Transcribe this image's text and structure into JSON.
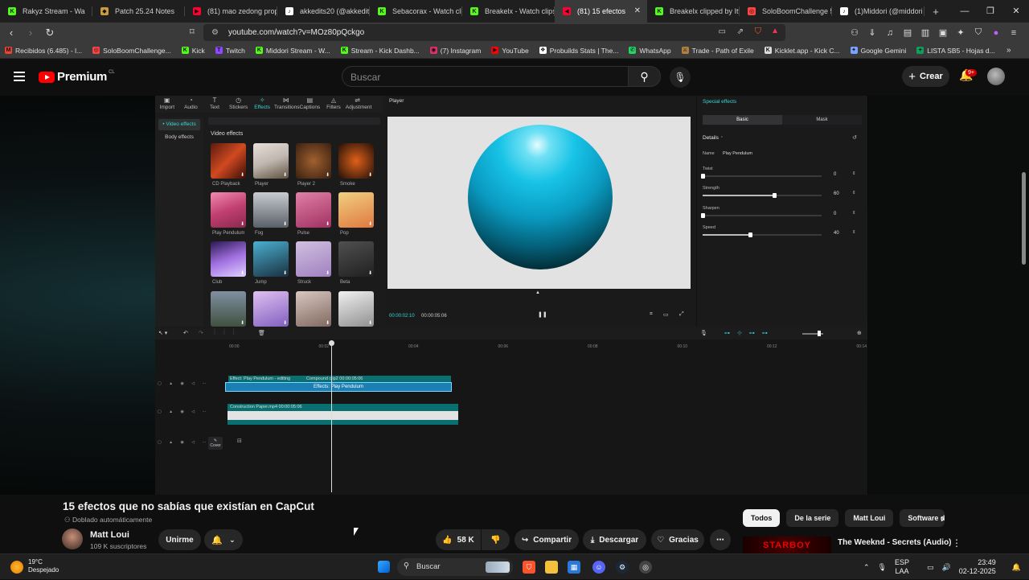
{
  "browser": {
    "tabs": [
      {
        "label": "Rakyz Stream - Wa",
        "fav_color": "#53fc18",
        "fav_glyph": "K"
      },
      {
        "label": "Patch 25.24 Notes",
        "fav_color": "#c89b3c",
        "fav_glyph": "◆"
      },
      {
        "label": "(81) mao zedong prop",
        "fav_color": "#ff0033",
        "fav_glyph": "▶"
      },
      {
        "label": "akkedits20 (@akkedits",
        "fav_color": "#ffffff",
        "fav_glyph": "♪"
      },
      {
        "label": "Sebacorax - Watch clip",
        "fav_color": "#53fc18",
        "fav_glyph": "K"
      },
      {
        "label": "Breakelx - Watch clips",
        "fav_color": "#53fc18",
        "fav_glyph": "K"
      },
      {
        "label": "(81) 15 efectos",
        "fav_color": "#ff0033",
        "fav_glyph": "◀",
        "active": true
      },
      {
        "label": "Breakelx clipped by Itt",
        "fav_color": "#53fc18",
        "fav_glyph": "K"
      },
      {
        "label": "SoloBoomChallenge 5",
        "fav_color": "#ff4444",
        "fav_glyph": "◎"
      },
      {
        "label": "(1)Middori (@middori",
        "fav_color": "#ffffff",
        "fav_glyph": "♪"
      }
    ],
    "url": "youtube.com/watch?v=MOz80pQckgo",
    "bookmarks": [
      {
        "label": "Recibidos (6.485) - l...",
        "color": "#ea4335",
        "glyph": "M"
      },
      {
        "label": "SoloBoomChallenge...",
        "color": "#ff4444",
        "glyph": "◎"
      },
      {
        "label": "Kick",
        "color": "#53fc18",
        "glyph": "K"
      },
      {
        "label": "Twitch",
        "color": "#9146ff",
        "glyph": "T"
      },
      {
        "label": "Middori Stream - W...",
        "color": "#53fc18",
        "glyph": "K"
      },
      {
        "label": "Stream - Kick Dashb...",
        "color": "#53fc18",
        "glyph": "K"
      },
      {
        "label": "(7) Instagram",
        "color": "#e1306c",
        "glyph": "◉"
      },
      {
        "label": "YouTube",
        "color": "#ff0000",
        "glyph": "▶"
      },
      {
        "label": "Probuilds Stats | The...",
        "color": "#ffffff",
        "glyph": "❖"
      },
      {
        "label": "WhatsApp",
        "color": "#25d366",
        "glyph": "✆"
      },
      {
        "label": "Trade - Path of Exile",
        "color": "#b08040",
        "glyph": "⚔"
      },
      {
        "label": "Kicklet.app - Kick C...",
        "color": "#dddddd",
        "glyph": "K"
      },
      {
        "label": "Google Gemini",
        "color": "#7aa2ff",
        "glyph": "✦"
      },
      {
        "label": "LISTA SB5 - Hojas d...",
        "color": "#0f9d58",
        "glyph": "+"
      }
    ]
  },
  "youtube": {
    "logo_text": "Premium",
    "logo_region": "CL",
    "search_placeholder": "Buscar",
    "create_label": "Crear",
    "notif_count": "9+",
    "video_title": "15 efectos que no sabías que existían en CapCut",
    "dub_note": "Doblado automáticamente",
    "channel_name": "Matt Loui",
    "subscribers": "109 K suscriptores",
    "join_label": "Unirme",
    "likes": "58 K",
    "share_label": "Compartir",
    "download_label": "Descargar",
    "thanks_label": "Gracias",
    "chips": [
      {
        "label": "Todos",
        "active": true
      },
      {
        "label": "De la serie"
      },
      {
        "label": "Matt Loui"
      },
      {
        "label": "Software de"
      }
    ],
    "rec_thumb_text": "STARBOY",
    "rec_title": "The Weeknd - Secrets (Audio)"
  },
  "capcut": {
    "tools": [
      {
        "label": "Import",
        "glyph": "▣"
      },
      {
        "label": "Audio",
        "glyph": "◔"
      },
      {
        "label": "Text",
        "glyph": "T"
      },
      {
        "label": "Stickers",
        "glyph": "◷"
      },
      {
        "label": "Effects",
        "glyph": "✧",
        "active": true
      },
      {
        "label": "Transitions",
        "glyph": "⋈"
      },
      {
        "label": "Captions",
        "glyph": "▤"
      },
      {
        "label": "Filters",
        "glyph": "◬"
      },
      {
        "label": "Adjustment",
        "glyph": "⇌"
      }
    ],
    "categories": [
      {
        "label": "• Video effects",
        "active": true
      },
      {
        "label": "Body effects"
      }
    ],
    "section_label": "Video effects",
    "effects": [
      {
        "label": "CD Playback",
        "bg": "linear-gradient(135deg,#5a1a10,#d04a20,#3a0d08)"
      },
      {
        "label": "Player",
        "bg": "linear-gradient(160deg,#e8e0d8,#c0b8b0,#605040)"
      },
      {
        "label": "Player 2",
        "bg": "radial-gradient(circle,#a06030,#3a2010)"
      },
      {
        "label": "Smoke",
        "bg": "radial-gradient(circle,#e0601a,#201008)"
      },
      {
        "label": "Play Pendulum",
        "bg": "linear-gradient(160deg,#f28ab0,#c04070,#8a2850)"
      },
      {
        "label": "Fog",
        "bg": "linear-gradient(180deg,#c8ccd0,#5a6068)"
      },
      {
        "label": "Pulse",
        "bg": "linear-gradient(160deg,#e080a8,#a03060)"
      },
      {
        "label": "Pop",
        "bg": "linear-gradient(160deg,#f0d080,#e07840)"
      },
      {
        "label": "Club",
        "bg": "linear-gradient(160deg,#2a1850,#a070e0,#e0d0ff)"
      },
      {
        "label": "Jump",
        "bg": "linear-gradient(160deg,#4ab0d0,#1a3040)"
      },
      {
        "label": "Struck",
        "bg": "linear-gradient(160deg,#d0c0e0,#a080c0)"
      },
      {
        "label": "Beta",
        "bg": "linear-gradient(160deg,#505050,#202020)"
      },
      {
        "label": "",
        "bg": "linear-gradient(180deg,#8090a0,#405040)"
      },
      {
        "label": "",
        "bg": "linear-gradient(160deg,#e0c0f0,#8060c0)"
      },
      {
        "label": "",
        "bg": "linear-gradient(160deg,#d8c8c0,#806860)"
      },
      {
        "label": "",
        "bg": "linear-gradient(160deg,#f0f0f0,#909090)"
      }
    ],
    "player_label": "Player",
    "time_current": "00:00:02:10",
    "time_total": "00:00:05:06",
    "panel_title": "Special effects",
    "seg_basic": "Basic",
    "seg_mask": "Mask",
    "details_label": "Details",
    "name_label": "Name",
    "name_value": "Play Pendulum",
    "params": [
      {
        "label": "Twist",
        "value": 0
      },
      {
        "label": "Strength",
        "value": 60
      },
      {
        "label": "Sharpen",
        "value": 0
      },
      {
        "label": "Speed",
        "value": 40
      }
    ],
    "ruler": [
      "00:00",
      "00:02",
      "00:04",
      "00:06",
      "00:08",
      "00:10",
      "00:12",
      "00:14"
    ],
    "clip_effect_tag": "Effect: Play Pendulum - editing",
    "clip_compound_tag": "Compound clip2  00:00:05:06",
    "clip_effect_label": "Effects: Play Pendulum",
    "clip_media_label": "Construction Paper.mp4  00:00:05:06",
    "cover_label": "Cover"
  },
  "taskbar": {
    "temp": "19°C",
    "weather": "Despejado",
    "search_label": "Buscar",
    "lang_top": "ESP",
    "lang_bottom": "LAA",
    "time": "23:49",
    "date": "02-12-2025"
  }
}
